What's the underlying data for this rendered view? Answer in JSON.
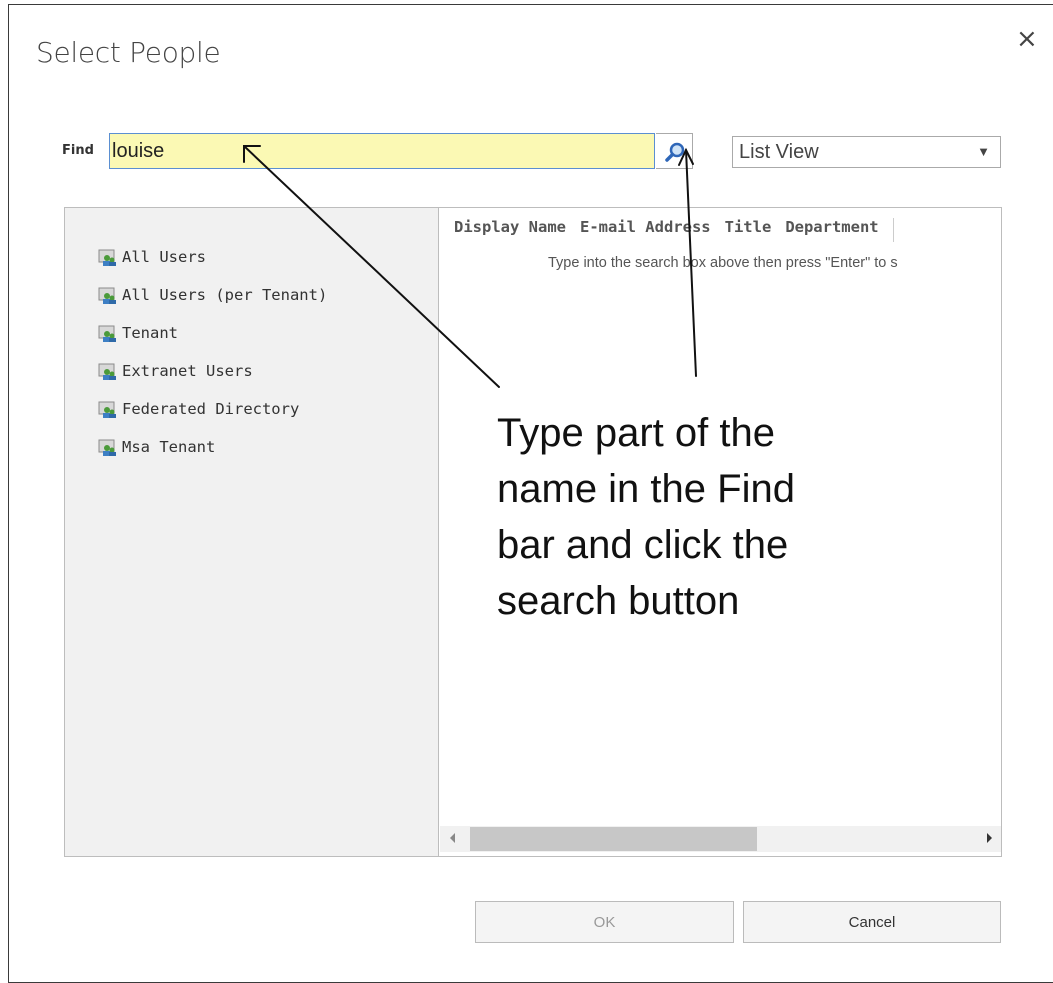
{
  "dialog": {
    "title": "Select People",
    "close_glyph": "×"
  },
  "find": {
    "label": "Find",
    "value": "louise",
    "search_icon": "search-icon"
  },
  "view_select": {
    "selected": "List View",
    "arrow": "▼"
  },
  "directories": [
    {
      "label": "All Users",
      "icon": "users-directory-icon"
    },
    {
      "label": "All Users (per Tenant)",
      "icon": "users-directory-icon"
    },
    {
      "label": "Tenant",
      "icon": "users-directory-icon"
    },
    {
      "label": "Extranet Users",
      "icon": "users-directory-icon"
    },
    {
      "label": "Federated Directory",
      "icon": "users-directory-icon"
    },
    {
      "label": "Msa Tenant",
      "icon": "users-directory-icon"
    }
  ],
  "grid": {
    "columns": [
      "Display Name",
      "E-mail Address",
      "Title",
      "Department"
    ],
    "hint": "Type into the search box above then press \"Enter\" to s"
  },
  "buttons": {
    "ok": "OK",
    "cancel": "Cancel"
  },
  "annotation": {
    "text": "Type part of the name in the Find bar and click the search button"
  }
}
